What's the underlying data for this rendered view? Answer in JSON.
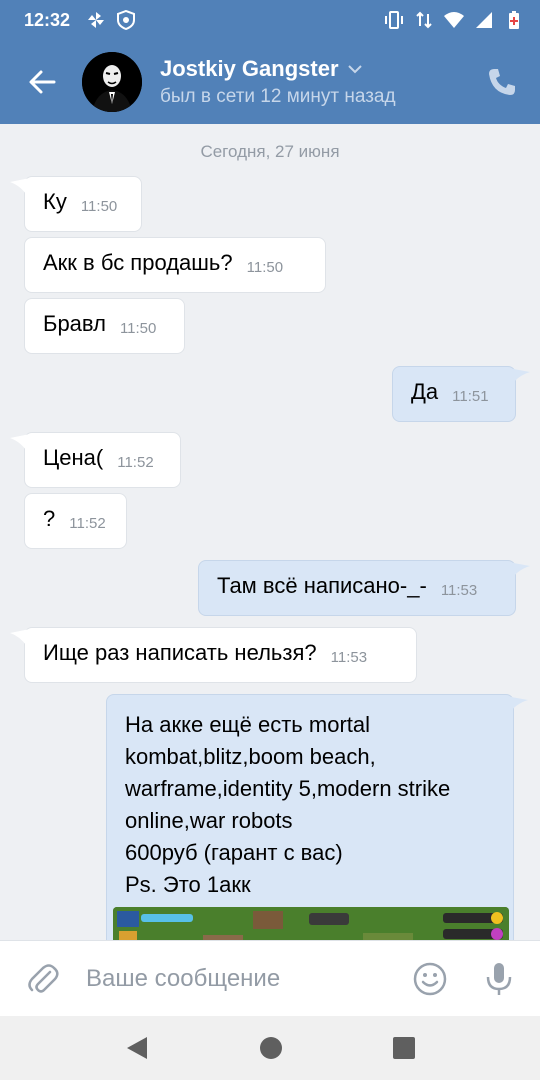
{
  "status_bar": {
    "time": "12:32"
  },
  "header": {
    "contact_name": "Jostkiy Gangster",
    "last_seen": "был в сети 12 минут назад"
  },
  "chat": {
    "date_separator": "Сегодня, 27 июня",
    "messages": [
      {
        "dir": "in",
        "text": "Ку",
        "time": "11:50"
      },
      {
        "dir": "in",
        "text": "Акк в бс продашь?",
        "time": "11:50"
      },
      {
        "dir": "in",
        "text": "Бравл",
        "time": "11:50"
      },
      {
        "dir": "out",
        "text": "Да",
        "time": "11:51"
      },
      {
        "dir": "in",
        "text": "Цена(",
        "time": "11:52"
      },
      {
        "dir": "in",
        "text": "?",
        "time": "11:52"
      },
      {
        "dir": "out",
        "text": "Там всё написано-_-",
        "time": "11:53"
      },
      {
        "dir": "in",
        "text": "Ище раз написать нельзя?",
        "time": "11:53"
      }
    ],
    "last_message_lines": [
      "На акке ещё есть mortal",
      "kombat,blitz,boom beach,",
      "warframe,identity 5,modern strike",
      "online,war robots",
      "600руб (гарант с вас)",
      "Ps. Это 1акк"
    ]
  },
  "composer": {
    "placeholder": "Ваше сообщение"
  },
  "colors": {
    "brand": "#5181b8",
    "incoming_bubble": "#ffffff",
    "outgoing_bubble": "#d9e6f6",
    "background": "#eef0f3"
  }
}
